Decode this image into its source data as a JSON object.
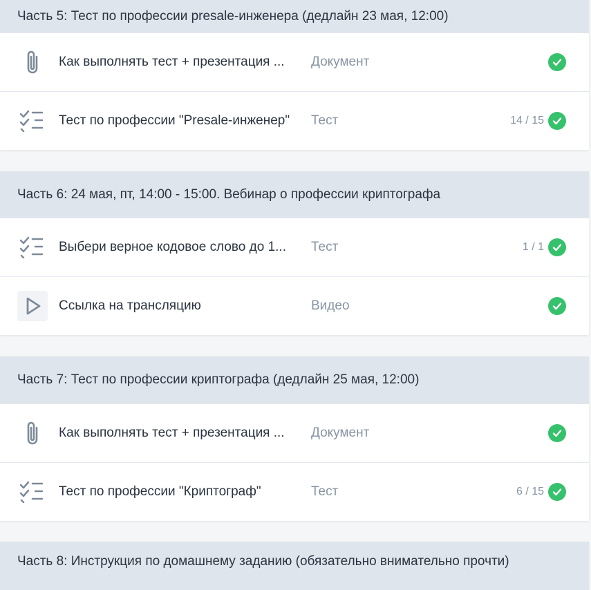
{
  "colors": {
    "header_bg": "#dfe5ed",
    "check_green": "#36c16c",
    "muted_text": "#8794a3",
    "icon_gray": "#7d8a99"
  },
  "sections": [
    {
      "header": "Часть 5: Тест по профессии presale-инженера (дедлайн 23 мая, 12:00)",
      "items": [
        {
          "icon": "paperclip-icon",
          "title": "Как выполнять тест + презентация ...",
          "type": "Документ",
          "score": "",
          "completed": true
        },
        {
          "icon": "checklist-icon",
          "title": "Тест по профессии \"Presale-инженер\"",
          "type": "Тест",
          "score": "14 / 15",
          "completed": true
        }
      ]
    },
    {
      "header": "Часть 6: 24 мая, пт, 14:00 - 15:00. Вебинар о профессии криптографа",
      "items": [
        {
          "icon": "checklist-icon",
          "title": "Выбери верное кодовое слово до 1...",
          "type": "Тест",
          "score": "1 / 1",
          "completed": true
        },
        {
          "icon": "play-icon",
          "title": "Ссылка на трансляцию",
          "type": "Видео",
          "score": "",
          "completed": true
        }
      ]
    },
    {
      "header": "Часть 7: Тест по профессии криптографа (дедлайн 25 мая, 12:00)",
      "items": [
        {
          "icon": "paperclip-icon",
          "title": "Как выполнять тест + презентация ...",
          "type": "Документ",
          "score": "",
          "completed": true
        },
        {
          "icon": "checklist-icon",
          "title": "Тест по профессии \"Криптограф\"",
          "type": "Тест",
          "score": "6 / 15",
          "completed": true
        }
      ]
    },
    {
      "header": "Часть 8: Инструкция по домашнему заданию (обязательно внимательно прочти)",
      "items": []
    }
  ]
}
